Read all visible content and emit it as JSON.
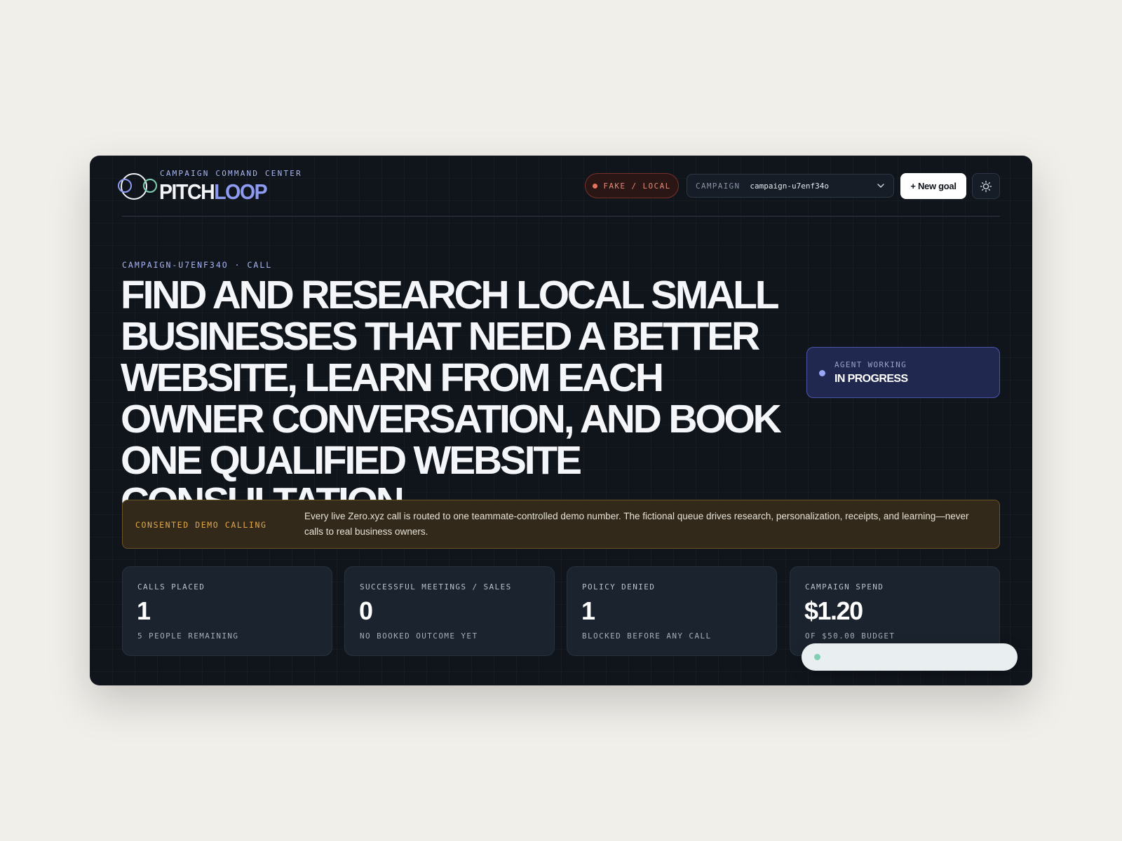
{
  "header": {
    "subtitle": "CAMPAIGN COMMAND CENTER",
    "brand_part1": "PITCH",
    "brand_part2": "LOOP",
    "mode_badge": "FAKE / LOCAL",
    "campaign_label": "CAMPAIGN",
    "campaign_value": "campaign-u7enf34o",
    "new_goal_label": "+ New goal",
    "theme_icon": "sun-icon"
  },
  "hero": {
    "breadcrumb": "CAMPAIGN-U7ENF34O · CALL",
    "headline": "Find and research local small businesses that need a better website, learn from each owner conversation, and book one qualified website consultation."
  },
  "agent_status": {
    "label": "AGENT WORKING",
    "value": "IN PROGRESS"
  },
  "notice": {
    "label": "CONSENTED DEMO CALLING",
    "text": "Every live Zero.xyz call is routed to one teammate-controlled demo number. The fictional queue drives research, personalization, receipts, and learning—never calls to real business owners."
  },
  "stats": [
    {
      "label": "CALLS PLACED",
      "value": "1",
      "sub": "5 PEOPLE REMAINING"
    },
    {
      "label": "SUCCESSFUL MEETINGS / SALES",
      "value": "0",
      "sub": "NO BOOKED OUTCOME YET"
    },
    {
      "label": "POLICY DENIED",
      "value": "1",
      "sub": "BLOCKED BEFORE ANY CALL"
    },
    {
      "label": "CAMPAIGN SPEND",
      "value": "$1.20",
      "sub": "OF $50.00 BUDGET"
    }
  ],
  "colors": {
    "background": "#10151c",
    "accent": "#8e9bf2",
    "warning": "#e0a848",
    "danger": "#e5735d",
    "toast_dot": "#7fd0b0"
  }
}
